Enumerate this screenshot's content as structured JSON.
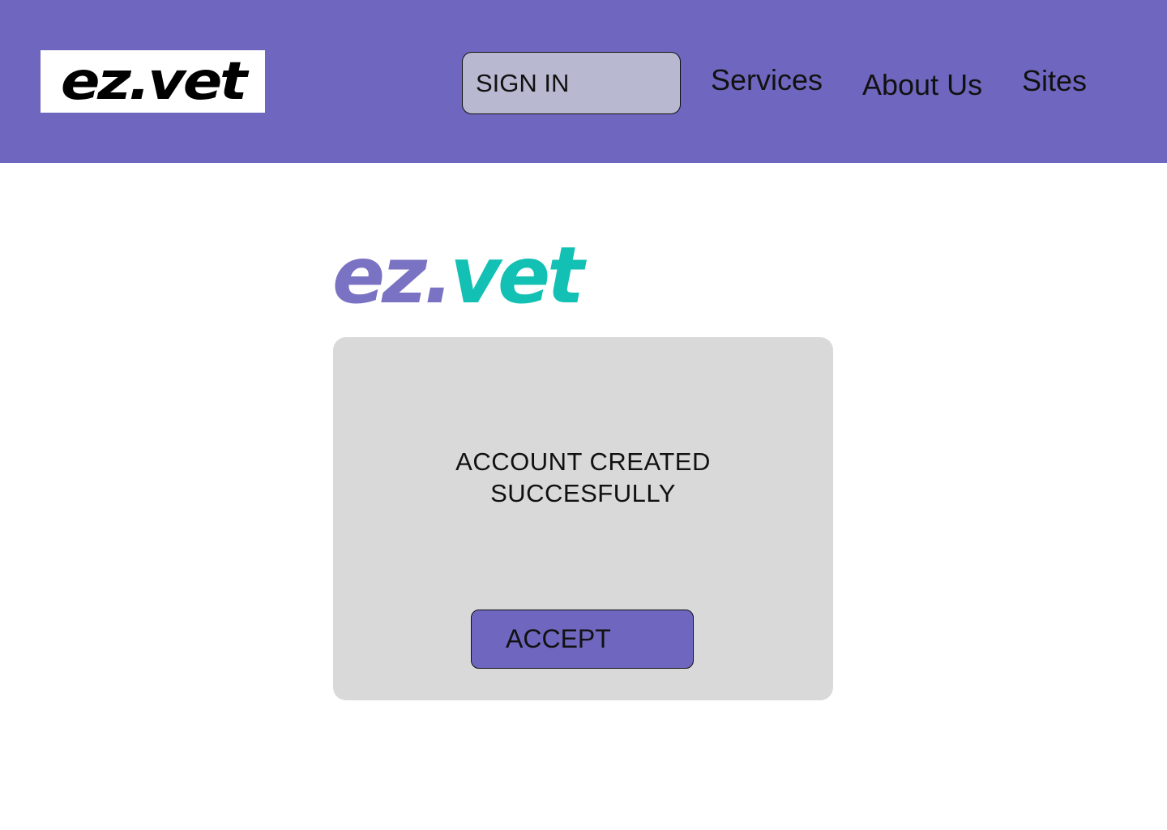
{
  "header": {
    "logo_text": "ez.vet",
    "signin_label": "SIGN IN",
    "nav": [
      {
        "label": "Services"
      },
      {
        "label": "About Us"
      },
      {
        "label": "Sites"
      }
    ]
  },
  "brand": {
    "ez": "ez.",
    "vet": "vet"
  },
  "dialog": {
    "message_line1": "ACCOUNT CREATED",
    "message_line2": "SUCCESFULLY",
    "accept_label": "ACCEPT"
  },
  "colors": {
    "header_bg": "#6f67bf",
    "signin_bg": "#b8b8d1",
    "dialog_bg": "#d9d9d9",
    "brand_ez": "#7a72c2",
    "brand_vet": "#12c1b3",
    "accept_bg": "#6f67bf"
  }
}
